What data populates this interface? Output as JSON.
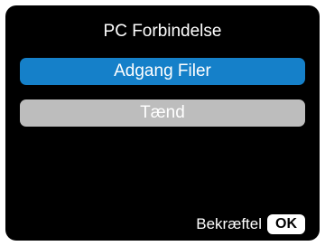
{
  "screen": {
    "title": "PC Forbindelse"
  },
  "menu": {
    "items": [
      {
        "label": "Adgang Filer",
        "selected": true
      },
      {
        "label": "Tænd",
        "selected": false
      }
    ]
  },
  "footer": {
    "confirm_label": "Bekræftel",
    "ok_key": "OK"
  },
  "colors": {
    "background": "#000000",
    "selected": "#1580c9",
    "unselected": "#bdbdbd",
    "text": "#ffffff"
  }
}
